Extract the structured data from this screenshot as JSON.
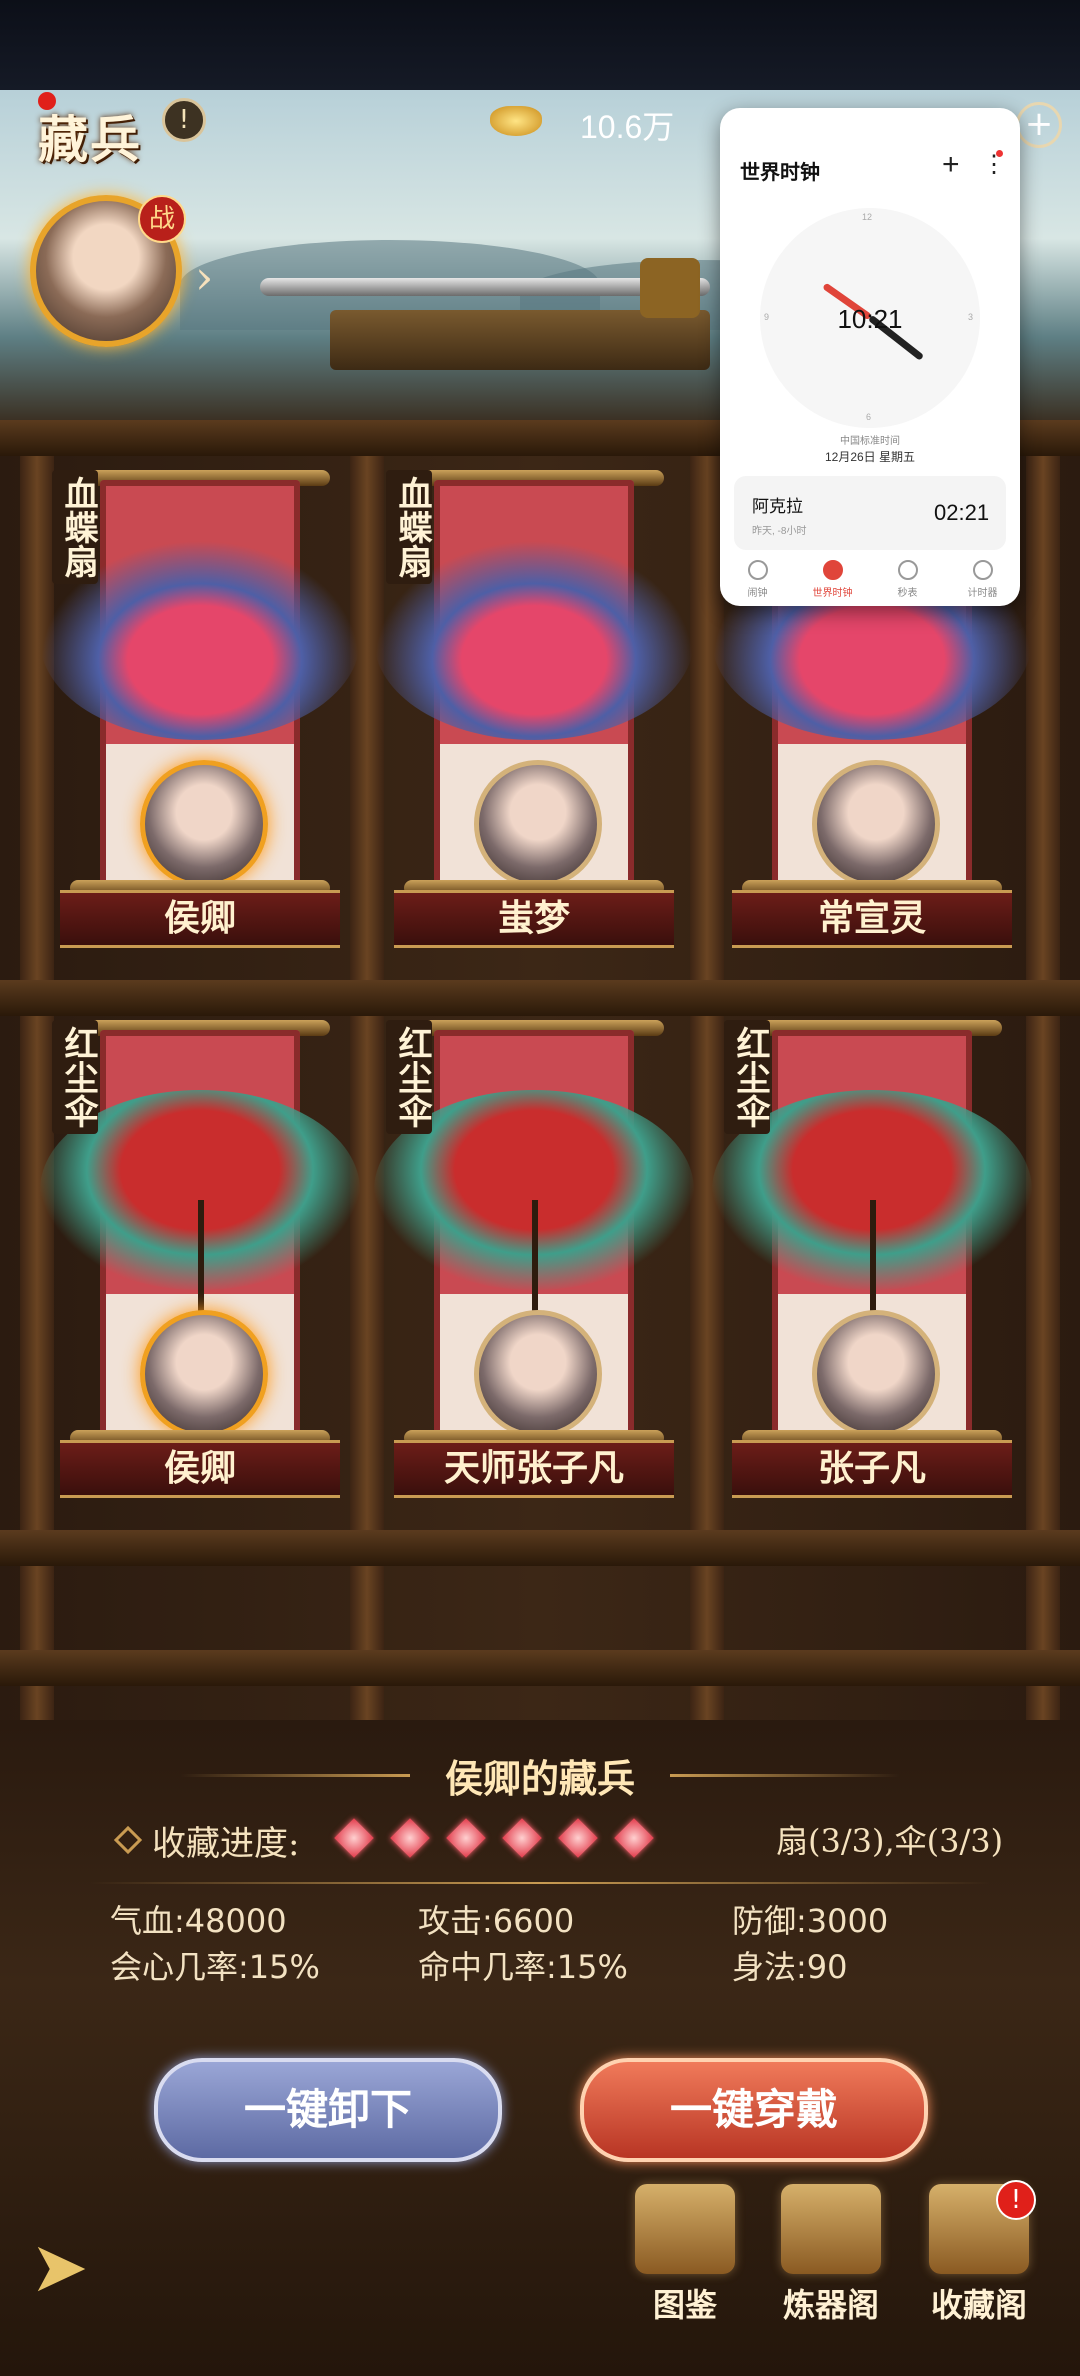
{
  "header": {
    "title": "藏兵",
    "info_icon": "!",
    "gold_value": "10.6万",
    "plus": "+",
    "battle_badge": "战"
  },
  "shelf": {
    "rows": [
      {
        "items": [
          {
            "weapon": "血蝶扇",
            "weapon_type": "fan",
            "owner": "侯卿",
            "active": true
          },
          {
            "weapon": "血蝶扇",
            "weapon_type": "fan",
            "owner": "蚩梦",
            "active": false
          },
          {
            "weapon": "血蝶扇",
            "weapon_type": "fan",
            "owner": "常宣灵",
            "active": false
          }
        ]
      },
      {
        "items": [
          {
            "weapon": "红尘伞",
            "weapon_type": "umbrella",
            "owner": "侯卿",
            "active": true
          },
          {
            "weapon": "红尘伞",
            "weapon_type": "umbrella",
            "owner": "天师张子凡",
            "active": false
          },
          {
            "weapon": "红尘伞",
            "weapon_type": "umbrella",
            "owner": "张子凡",
            "active": false
          }
        ]
      }
    ]
  },
  "collection": {
    "title": "侯卿的藏兵",
    "progress_label": "收藏进度:",
    "gems_filled": 6,
    "progress_count": "扇(3/3),伞(3/3)",
    "stats": [
      {
        "label": "气血:",
        "value": "48000"
      },
      {
        "label": "攻击:",
        "value": "6600"
      },
      {
        "label": "防御:",
        "value": "3000"
      },
      {
        "label": "会心几率:",
        "value": "15%"
      },
      {
        "label": "命中几率:",
        "value": "15%"
      },
      {
        "label": "身法:",
        "value": "90"
      }
    ]
  },
  "buttons": {
    "unequip": "一键卸下",
    "equip": "一键穿戴"
  },
  "bottom_nav": {
    "items": [
      {
        "label": "图鉴",
        "icon": "scroll-icon"
      },
      {
        "label": "炼器阁",
        "icon": "forge-icon"
      },
      {
        "label": "收藏阁",
        "icon": "pavilion-icon"
      }
    ],
    "badge": "!"
  },
  "clock_widget": {
    "title": "世界时钟",
    "add": "+",
    "menu": "⋮",
    "dial_12": "12",
    "dial_3": "3",
    "dial_6": "6",
    "dial_9": "9",
    "time": "10:21",
    "location": "中国标准时间",
    "date": "12月26日 星期五",
    "city": {
      "name": "阿克拉",
      "sub": "昨天, -8小时",
      "time": "02:21"
    },
    "tabs": [
      {
        "label": "闹钟",
        "active": false
      },
      {
        "label": "世界时钟",
        "active": true
      },
      {
        "label": "秒表",
        "active": false
      },
      {
        "label": "计时器",
        "active": false
      }
    ],
    "accent": "#e0453a"
  }
}
